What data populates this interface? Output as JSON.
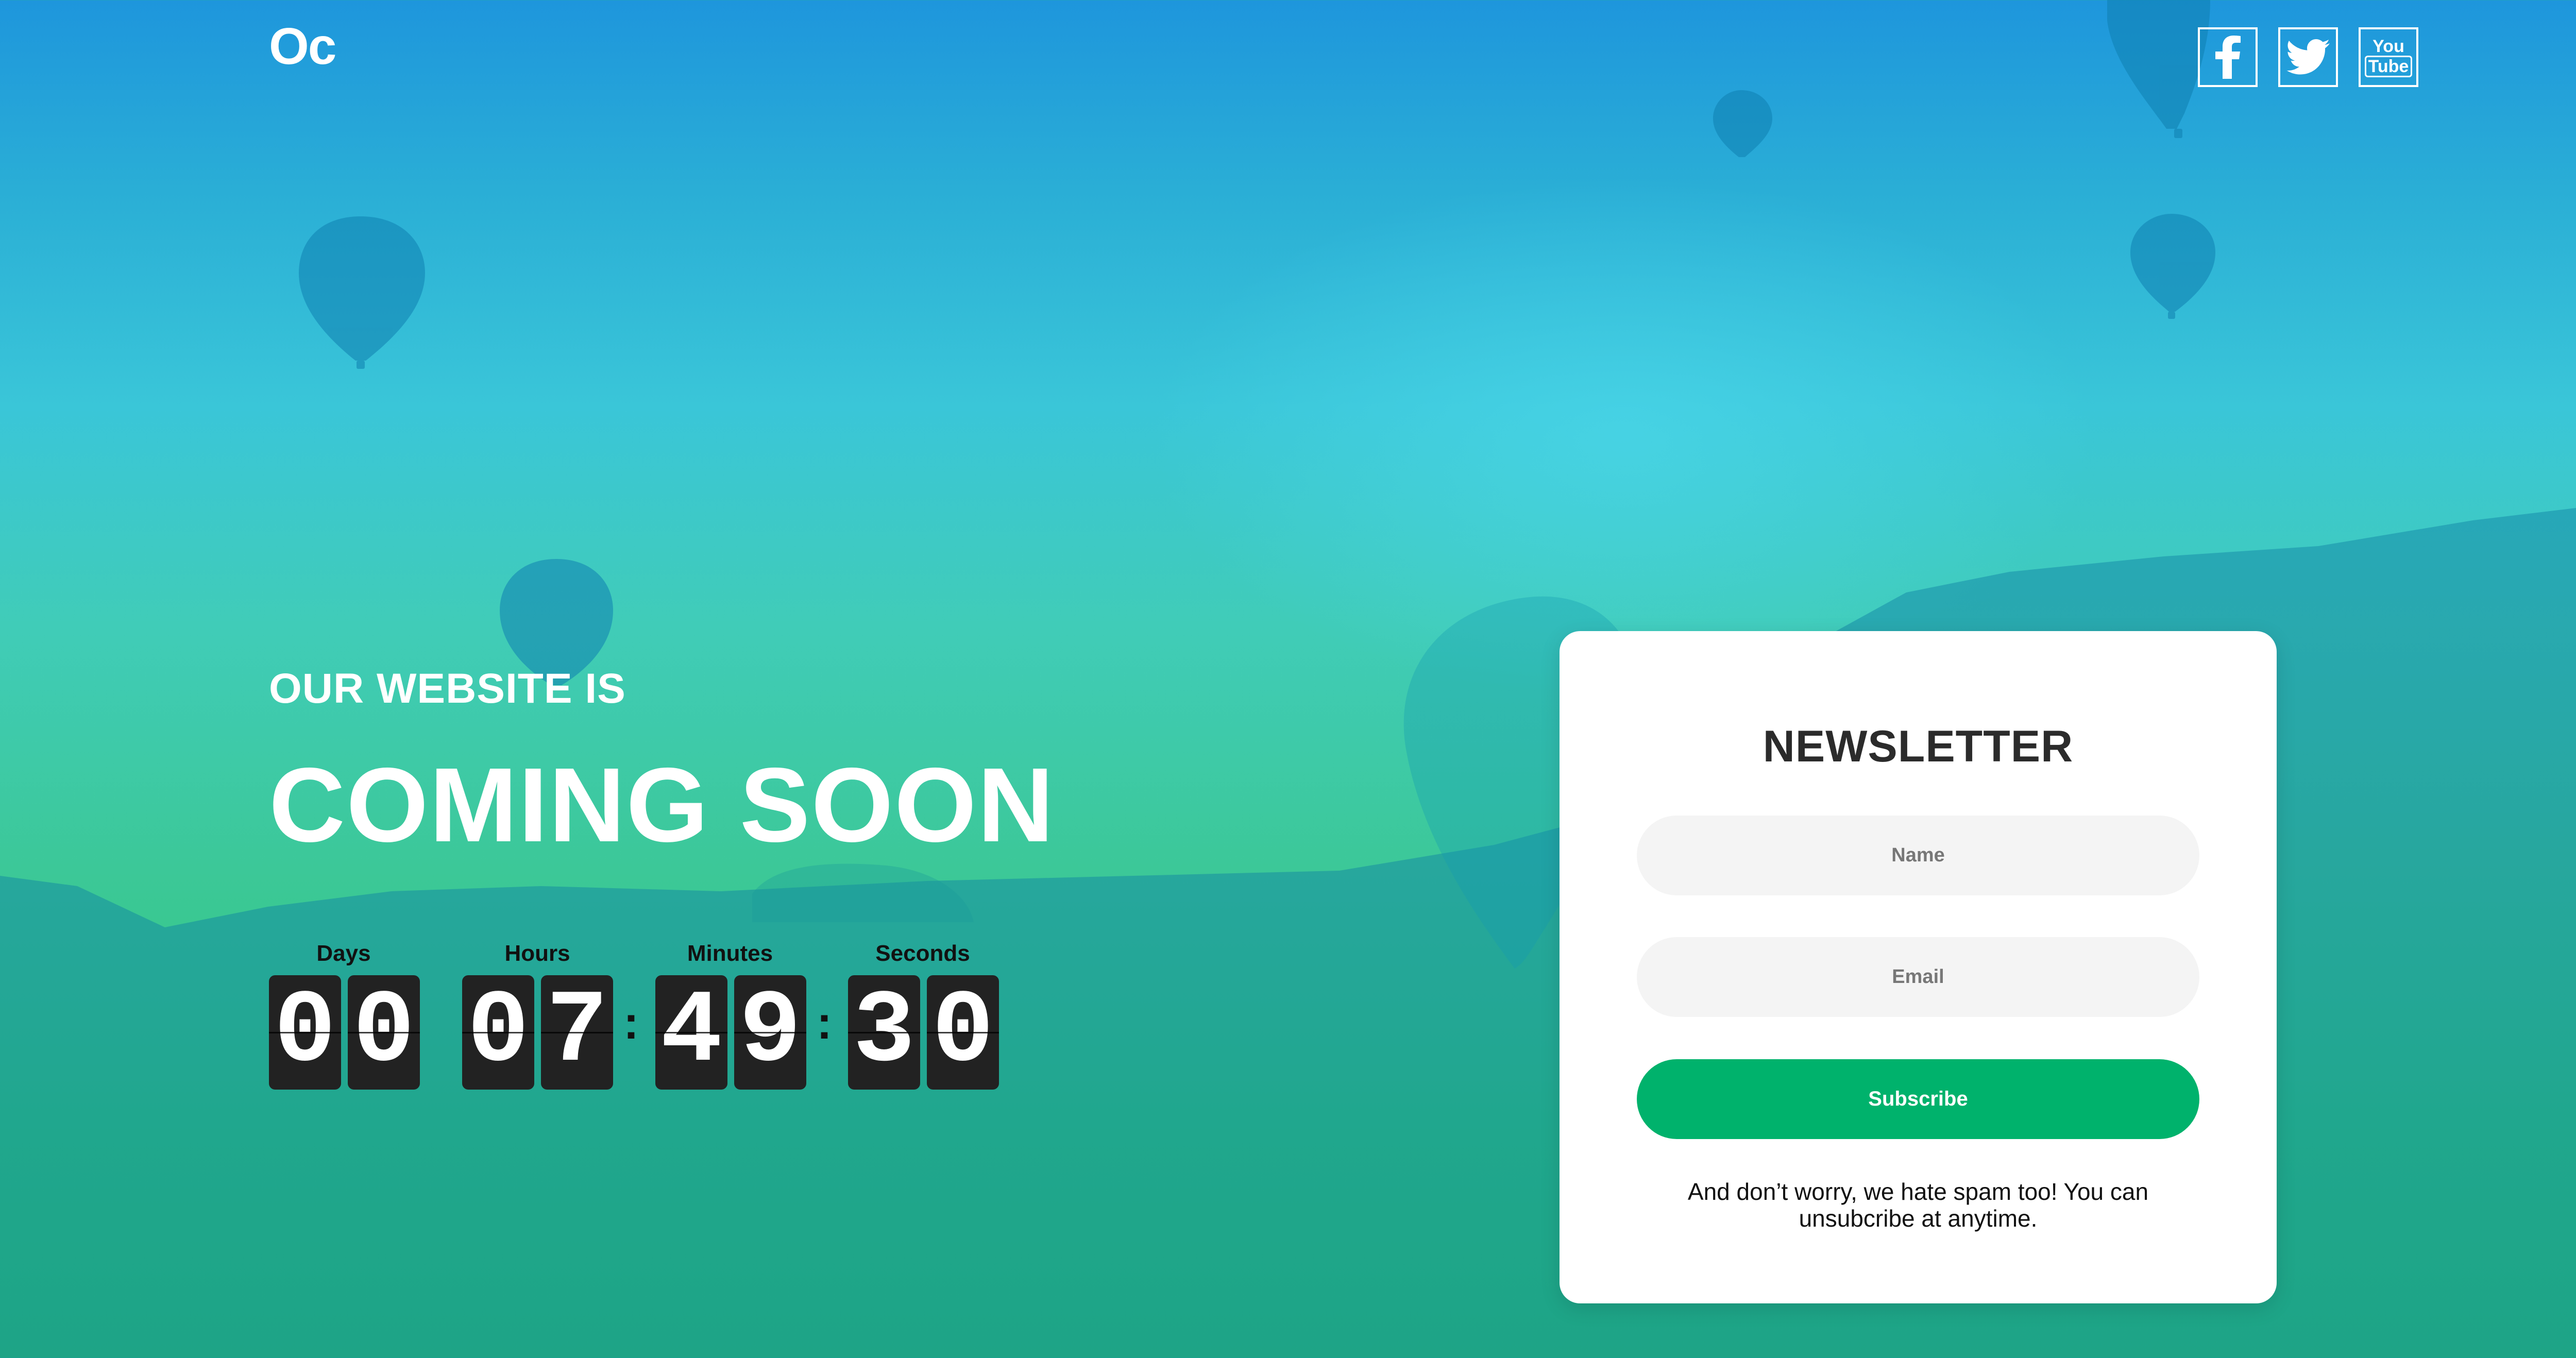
{
  "brand": {
    "logo_text": "Oc"
  },
  "social": [
    {
      "name": "facebook",
      "icon": "facebook-icon"
    },
    {
      "name": "twitter",
      "icon": "twitter-icon"
    },
    {
      "name": "youtube",
      "icon": "youtube-icon",
      "text_top": "You",
      "text_bottom": "Tube"
    }
  ],
  "hero": {
    "intro": "OUR WEBSITE IS",
    "headline": "COMING SOON"
  },
  "countdown": {
    "labels": [
      "Days",
      "Hours",
      "Minutes",
      "Seconds"
    ],
    "days": [
      "0",
      "0"
    ],
    "hours": [
      "0",
      "7"
    ],
    "minutes": [
      "4",
      "9"
    ],
    "seconds": [
      "3",
      "0"
    ],
    "separator": ":"
  },
  "newsletter": {
    "title": "NEWSLETTER",
    "name_placeholder": "Name",
    "email_placeholder": "Email",
    "subscribe_label": "Subscribe",
    "note": "And don’t worry, we hate spam too! You can unsubcribe at anytime."
  },
  "colors": {
    "accent": "#00b26c",
    "background_top": "#1e96dc",
    "background_bottom": "#2cc46e",
    "flip_card": "#222222"
  }
}
